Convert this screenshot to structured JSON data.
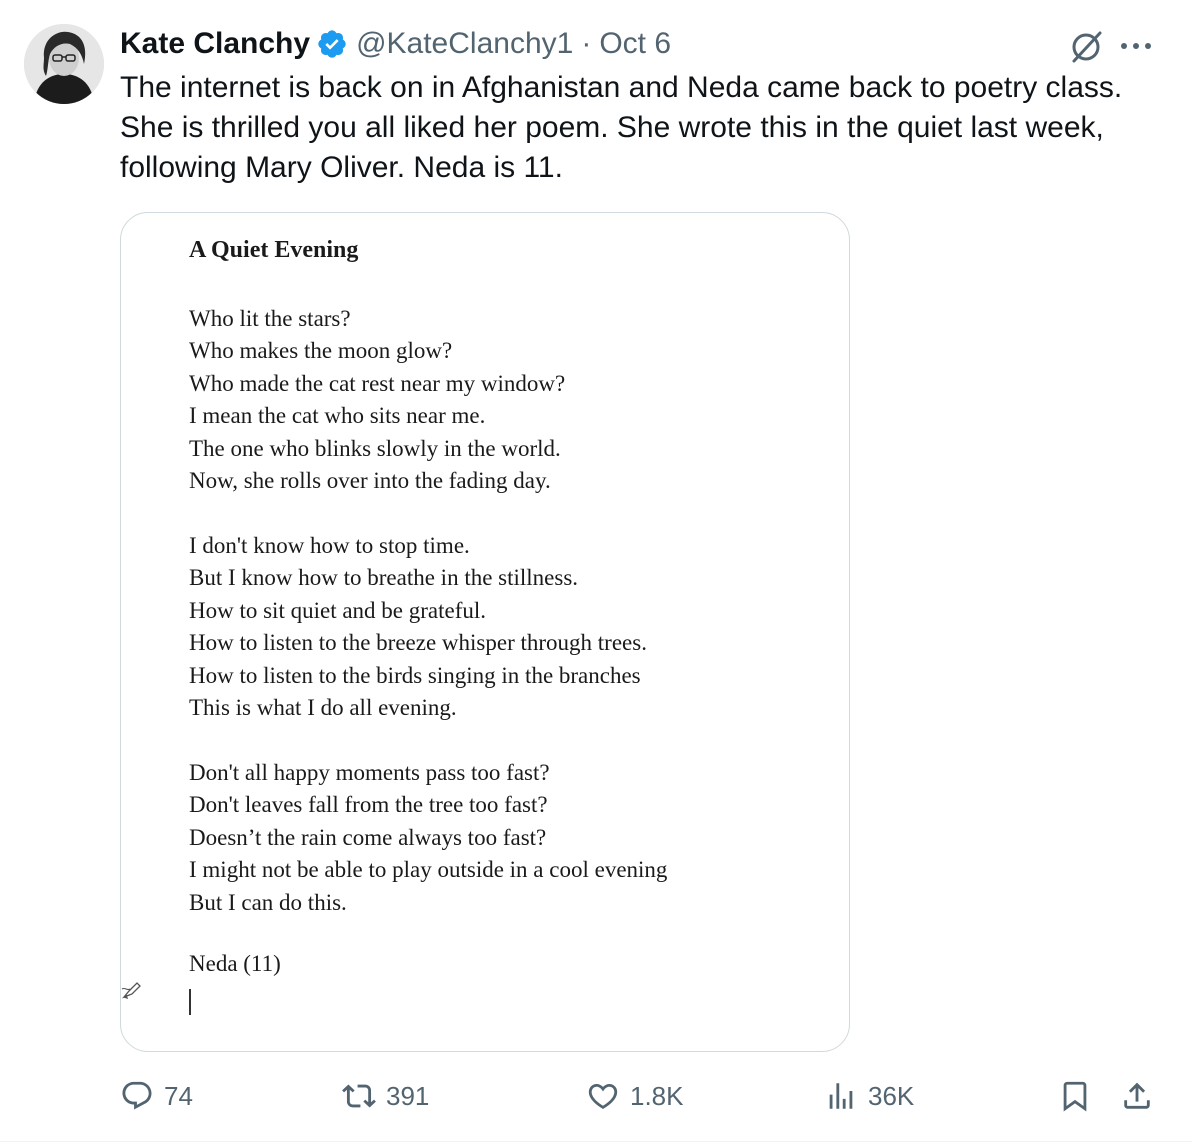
{
  "author": {
    "display_name": "Kate Clanchy",
    "handle": "@KateClanchy1",
    "separator": "·",
    "date": "Oct 6",
    "verified": true,
    "avatar": "avatar-photo"
  },
  "tweet": {
    "text": "The internet is back on in Afghanistan and Neda came back to poetry class. She is thrilled you all liked her poem. She wrote this in the quiet last week, following Mary Oliver. Neda is 11."
  },
  "poem": {
    "title": "A Quiet Evening",
    "stanzas": [
      [
        "Who lit the stars?",
        "Who makes the moon glow?",
        "Who made the cat rest near my window?",
        "I mean the cat who sits near me.",
        "The one who blinks slowly in the world.",
        "Now, she rolls over into the fading day."
      ],
      [
        "I don't know how to stop time.",
        "But I know how to breathe in the stillness.",
        "How to sit quiet and be grateful.",
        "How to listen to the breeze whisper through trees.",
        "How to listen to the birds singing in the branches",
        "This is what I do all evening."
      ],
      [
        "Don't all happy moments pass too fast?",
        "Don't leaves fall from the tree too fast?",
        "Doesn’t the rain come always too fast?",
        "I might not be able to play outside in a cool evening",
        "But I can do this."
      ]
    ],
    "author_line": "Neda (11)"
  },
  "actions": {
    "replies": "74",
    "reposts": "391",
    "likes": "1.8K",
    "views": "36K"
  },
  "icons": {
    "verified": "verified-badge-icon",
    "grok": "grok-icon",
    "more": "more-icon",
    "reply": "reply-icon",
    "retweet": "retweet-icon",
    "like": "heart-icon",
    "views": "views-icon",
    "bookmark": "bookmark-icon",
    "share": "share-icon"
  },
  "colors": {
    "text": "#0f1419",
    "secondary": "#536471",
    "verified": "#1d9bf0",
    "border": "#cfd9de"
  }
}
